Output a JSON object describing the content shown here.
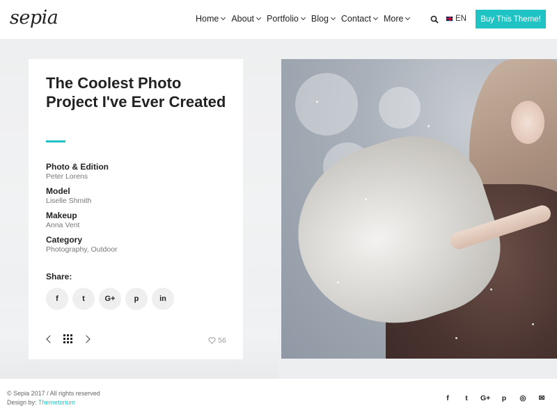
{
  "header": {
    "logo": "sepia",
    "nav": [
      {
        "label": "Home"
      },
      {
        "label": "About"
      },
      {
        "label": "Portfolio"
      },
      {
        "label": "Blog"
      },
      {
        "label": "Contact"
      },
      {
        "label": "More"
      }
    ],
    "language": "EN",
    "buy_label": "Buy This Theme!",
    "accent_color": "#1fc3c4"
  },
  "project": {
    "title": "The Coolest Photo Project I've Ever Created",
    "meta": [
      {
        "label": "Photo & Edition",
        "value": "Peter Lorens"
      },
      {
        "label": "Model",
        "value": "Liselle Shmith"
      },
      {
        "label": "Makeup",
        "value": "Anna Vent"
      },
      {
        "label": "Category",
        "value": "Photography, Outdoor"
      }
    ],
    "share_label": "Share:",
    "share_icons": [
      "facebook-icon",
      "twitter-icon",
      "google-plus-icon",
      "pinterest-icon",
      "linkedin-icon"
    ],
    "share_glyphs": [
      "f",
      "t",
      "G+",
      "p",
      "in"
    ],
    "likes": "56"
  },
  "footer": {
    "copyright": "© Sepia 2017 / All rights reserved",
    "design_by": "Design by:",
    "designer": "Themetorium",
    "social_glyphs": [
      "f",
      "t",
      "G+",
      "p",
      "◎",
      "✉"
    ]
  }
}
